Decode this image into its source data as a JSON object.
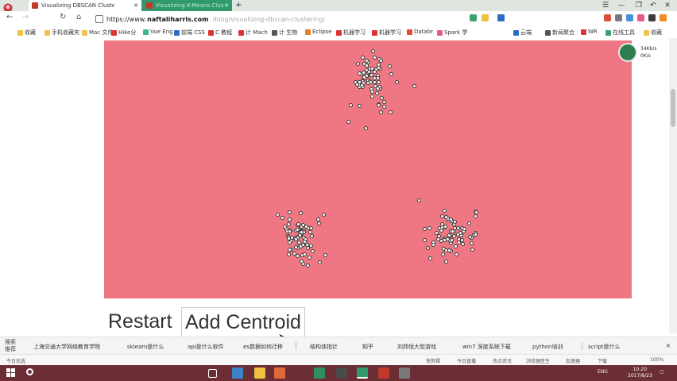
{
  "browser": {
    "tabs": [
      {
        "label": "Visualizing DBSCAN Clusteri",
        "active": true
      },
      {
        "label": "Visualizing K-Means Cluster",
        "active": false
      }
    ],
    "url": {
      "scheme": "https://www.",
      "host": "naftaliharris.com",
      "path": "/blog/visualizing-dbscan-clustering/"
    },
    "bookmarks": [
      "收藏",
      "手机收藏夹",
      "Mac 文件",
      "Hike分",
      "Vue Eng",
      "前端 CSS",
      "C 教程",
      "计 Mach",
      "计 生物",
      "Eclipse",
      "机器学习",
      "机器学习",
      "Databr",
      "Spark 学",
      "云端",
      "新闻聚合",
      "WR",
      "在线工具",
      "收藏"
    ],
    "scale_icon": "zoom-icon"
  },
  "page": {
    "restart_label": "Restart",
    "add_centroid_label": "Add Centroid",
    "widget_line1": "34Kb/s",
    "widget_line2": "0K/s",
    "canvas_color": "#ee7783"
  },
  "suggestions": {
    "title": "搜索\n推荐",
    "items": [
      "上海交通大学网络教育学院",
      "sklearn是什么",
      "api是什么软件",
      "es数据如何迁移",
      "结构体指针",
      "知乎",
      "刘邦恒大型游戏",
      "win7 深度系统下载",
      "python培训",
      "script是什么"
    ]
  },
  "statusbar": {
    "left": "今日优选",
    "items": [
      "快剪辑",
      "今日直播",
      "热点资讯",
      "浏览器医生",
      "加速器",
      "下载",
      "100%"
    ]
  },
  "taskbar": {
    "time": "10:20",
    "date": "2017/8/23",
    "tray_text": "ENG"
  }
}
